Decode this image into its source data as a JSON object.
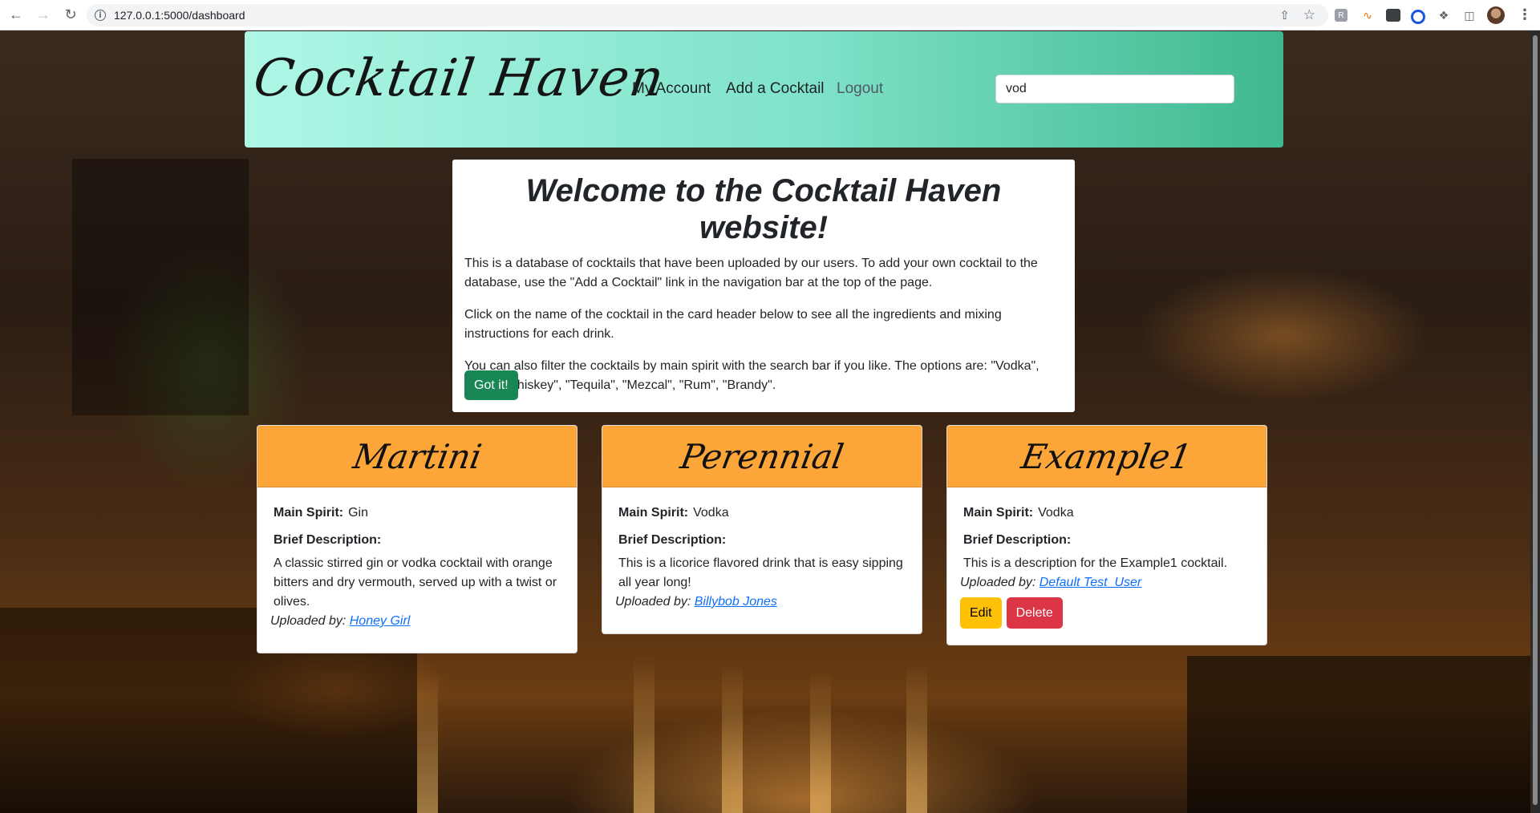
{
  "browser": {
    "url": "127.0.0.1:5000/dashboard",
    "back_icon": "back-arrow-icon",
    "forward_icon": "forward-arrow-icon",
    "reload_icon": "reload-icon"
  },
  "navbar": {
    "brand": "Cocktail Haven",
    "links": {
      "account": "My Account",
      "add": "Add a Cocktail",
      "logout": "Logout"
    },
    "search_value": "vod"
  },
  "welcome": {
    "title": "Welcome to the Cocktail Haven website!",
    "paragraphs": [
      "This is a database of cocktails that have been uploaded by our users. To add your own cocktail to the database, use the \"Add a Cocktail\" link in the navigation bar at the top of the page.",
      "Click on the name of the cocktail in the card header below to see all the ingredients and mixing instructions for each drink.",
      "You can also filter the cocktails by main spirit with the search bar if you like. The options are: \"Vodka\", \"Gin\", \"Whiskey\", \"Tequila\", \"Mezcal\", \"Rum\", \"Brandy\"."
    ],
    "button": "Got it!"
  },
  "labels": {
    "main_spirit": "Main Spirit:",
    "brief_description": "Brief Description:",
    "uploaded_by": "Uploaded by:"
  },
  "cards": [
    {
      "name": "Martini",
      "spirit": "Gin",
      "description": "A classic stirred gin or vodka cocktail with orange bitters and dry vermouth, served up with a twist or olives.",
      "uploader": "Honey Girl"
    },
    {
      "name": "Perennial",
      "spirit": "Vodka",
      "description": "This is a licorice flavored drink that is easy sipping all year long!",
      "uploader": "Billybob Jones"
    },
    {
      "name": "Example1",
      "spirit": "Vodka",
      "description": "This is a description for the Example1 cocktail.",
      "uploader": "Default Test_User",
      "edit": "Edit",
      "delete": "Delete"
    }
  ],
  "colors": {
    "navbar_start": "#aef7e6",
    "navbar_end": "#3fb88f",
    "card_header": "#fca63a",
    "got_it": "#198754",
    "edit": "#ffc107",
    "delete": "#dc3545",
    "link": "#0d6efd"
  }
}
